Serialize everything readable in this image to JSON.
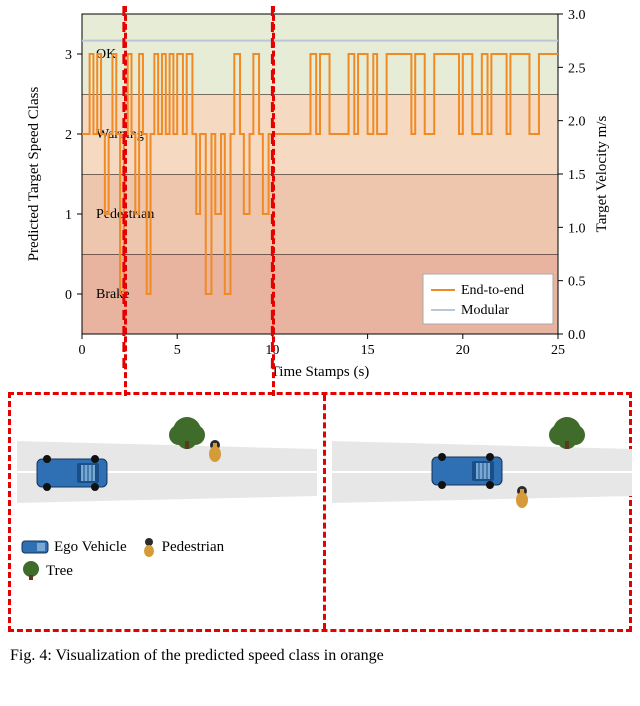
{
  "chart_data": {
    "type": "step-line",
    "title": "",
    "x_label": "Time Stamps (s)",
    "y_left_label": "Predicted Target Speed Class",
    "y_right_label": "Target Velocity m/s",
    "x_ticks": [
      0,
      5,
      10,
      15,
      20,
      25
    ],
    "y_left_ticks": [
      0,
      1,
      2,
      3
    ],
    "y_right_ticks": [
      0.0,
      0.5,
      1.0,
      1.5,
      2.0,
      2.5,
      3.0
    ],
    "y_right_range": [
      0.0,
      3.0
    ],
    "class_bands": [
      {
        "label": "Brake",
        "index": 0,
        "color": "#e8b39f"
      },
      {
        "label": "Pedestrian",
        "index": 1,
        "color": "#eec5ad"
      },
      {
        "label": "Warning",
        "index": 2,
        "color": "#f5d9c0"
      },
      {
        "label": "OK",
        "index": 3,
        "color": "#e6ecd5"
      }
    ],
    "series": [
      {
        "name": "End-to-end",
        "color": "#f08a24",
        "x": [
          0,
          0.3,
          0.4,
          0.6,
          0.8,
          1.0,
          1.2,
          1.4,
          1.6,
          1.8,
          2.0,
          2.2,
          2.4,
          2.6,
          2.8,
          3.0,
          3.2,
          3.4,
          3.6,
          3.8,
          4.0,
          4.2,
          4.4,
          4.6,
          4.8,
          5.0,
          5.3,
          5.5,
          5.8,
          6.0,
          6.2,
          6.5,
          6.8,
          7.0,
          7.3,
          7.5,
          7.8,
          8.0,
          8.3,
          8.5,
          8.8,
          9.0,
          9.3,
          9.5,
          9.8,
          10.0,
          10.5,
          11.0,
          11.5,
          12.0,
          12.3,
          12.5,
          13.0,
          13.5,
          14.0,
          14.3,
          14.5,
          15.0,
          15.3,
          15.5,
          16.0,
          16.5,
          17.0,
          17.3,
          17.5,
          18.0,
          18.5,
          19.0,
          19.5,
          19.8,
          20.0,
          20.5,
          21.0,
          21.3,
          21.5,
          22.0,
          22.3,
          22.5,
          23.0,
          23.5,
          24.0,
          24.5,
          25.0
        ],
        "y": [
          2,
          2,
          3,
          2,
          3,
          2,
          1,
          2,
          3,
          2,
          0,
          2,
          3,
          2,
          1,
          3,
          2,
          0,
          2,
          3,
          2,
          3,
          2,
          3,
          2,
          3,
          2,
          3,
          2,
          1,
          2,
          0,
          2,
          1,
          2,
          0,
          2,
          3,
          2,
          1,
          2,
          3,
          2,
          1,
          2,
          2,
          2,
          2,
          2,
          3,
          2,
          3,
          2,
          2,
          3,
          2,
          3,
          2,
          3,
          2,
          3,
          3,
          3,
          2,
          3,
          2,
          3,
          3,
          3,
          2,
          3,
          2,
          3,
          2,
          3,
          3,
          2,
          3,
          3,
          2,
          3,
          3,
          3
        ]
      },
      {
        "name": "Modular",
        "color": "#b9c8d6",
        "x": [
          0,
          25
        ],
        "y": [
          2.75,
          2.75
        ],
        "axis": "right"
      }
    ],
    "callout_times": [
      2.2,
      10.0
    ]
  },
  "legend": {
    "end_to_end": "End-to-end",
    "modular": "Modular"
  },
  "scenario_legend": {
    "ego": "Ego Vehicle",
    "pedestrian": "Pedestrian",
    "tree": "Tree"
  },
  "caption": "Fig. 4: Visualization of the predicted speed class in orange"
}
